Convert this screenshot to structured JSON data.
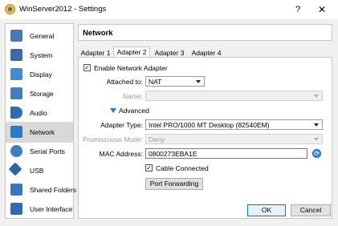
{
  "window": {
    "title": "WinServer2012 - Settings",
    "help_glyph": "?",
    "close_glyph": "✕"
  },
  "sidebar": {
    "items": [
      {
        "label": "General",
        "icon": "general-icon",
        "color": "#4a78b8"
      },
      {
        "label": "System",
        "icon": "system-icon",
        "color": "#3a6aa8"
      },
      {
        "label": "Display",
        "icon": "display-icon",
        "color": "#3f8bd6"
      },
      {
        "label": "Storage",
        "icon": "storage-icon",
        "color": "#3e7fc0"
      },
      {
        "label": "Audio",
        "icon": "audio-icon",
        "color": "#2f6cb4"
      },
      {
        "label": "Network",
        "icon": "network-icon",
        "color": "#2a7ad0",
        "selected": true
      },
      {
        "label": "Serial Ports",
        "icon": "serial-port-icon",
        "color": "#3c7dc4"
      },
      {
        "label": "USB",
        "icon": "usb-icon",
        "color": "#2f64a8"
      },
      {
        "label": "Shared Folders",
        "icon": "shared-folder-icon",
        "color": "#3577c2"
      },
      {
        "label": "User Interface",
        "icon": "user-interface-icon",
        "color": "#2e6bb8"
      }
    ]
  },
  "section": {
    "title": "Network"
  },
  "tabs": [
    {
      "label": "Adapter 1",
      "active": false
    },
    {
      "label": "Adapter 2",
      "active": true
    },
    {
      "label": "Adapter 3",
      "active": false
    },
    {
      "label": "Adapter 4",
      "active": false
    }
  ],
  "adapter": {
    "enable_label": "Enable Network Adapter",
    "enable_checked": true,
    "attached_to_label": "Attached to:",
    "attached_to_value": "NAT",
    "name_label": "Name:",
    "name_value": "",
    "advanced_label": "Advanced",
    "adapter_type_label": "Adapter Type:",
    "adapter_type_value": "Intel PRO/1000 MT Desktop (82540EM)",
    "promiscuous_label": "Promiscuous Mode:",
    "promiscuous_value": "Deny",
    "mac_label": "MAC Address:",
    "mac_value": "0800273EBA1E",
    "cable_label": "Cable Connected",
    "cable_checked": true,
    "port_forwarding_label": "Port Forwarding"
  },
  "footer": {
    "ok_label": "OK",
    "cancel_label": "Cancel"
  }
}
